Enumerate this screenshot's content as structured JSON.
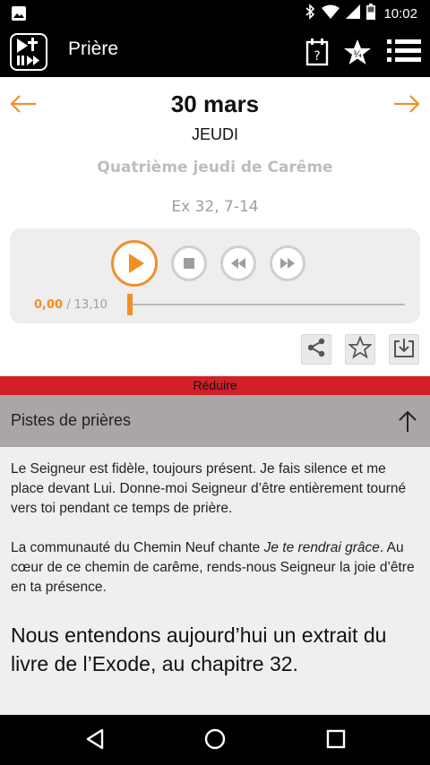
{
  "status_bar": {
    "time": "10:02",
    "icons": [
      "image-icon",
      "bluetooth-icon",
      "wifi-icon",
      "signal-icon",
      "battery-icon"
    ]
  },
  "app_bar": {
    "title": "Prière",
    "icons": [
      "app-logo-icon",
      "calendar-icon",
      "favorites-star-icon",
      "menu-icon"
    ]
  },
  "day": {
    "date": "30 mars",
    "weekday": "JEUDI",
    "feast": "Quatrième jeudi de Carême",
    "reference": "Ex 32, 7-14"
  },
  "player": {
    "current_time": "0,00",
    "separator": " / ",
    "total_time": "13,10",
    "progress_fraction": 0.0
  },
  "tools": [
    "share-icon",
    "favorite-star-icon",
    "download-icon"
  ],
  "reduce_label": "Réduire",
  "section": {
    "title": "Pistes de prières",
    "paragraph1": "Le Seigneur est fidèle, toujours présent. Je fais silence et me place devant Lui. Donne-moi Seigneur d’être entièrement tourné vers toi pendant ce temps de prière.",
    "paragraph2_before": "La communauté du Chemin Neuf chante ",
    "paragraph2_italic": "Je te rendrai grâce",
    "paragraph2_after": ". Au cœur de ce chemin de carême, rends-nous Seigneur la joie d’être en ta présence.",
    "highlight": "Nous entendons aujourd’hui un extrait du livre de l’Exode, au chapitre 32."
  },
  "colors": {
    "accent": "#f18f26",
    "reduce_bar": "#d12027",
    "section_header": "#a9a6a5",
    "bars": "#000000"
  }
}
